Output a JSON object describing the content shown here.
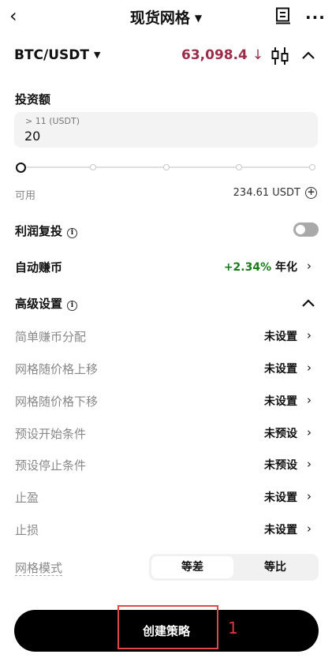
{
  "header": {
    "title": "现货网格"
  },
  "pair": {
    "symbol": "BTC/USDT",
    "price": "63,098.4",
    "price_color": "#9b2c4a"
  },
  "invest": {
    "label": "投资额",
    "hint": "> 11 (USDT)",
    "value": "20",
    "slider_level_percent": 0
  },
  "available": {
    "label": "可用",
    "value": "234.61 USDT"
  },
  "reinvest": {
    "label": "利润复投",
    "toggle_on": false
  },
  "auto_earn": {
    "label": "自动赚币",
    "rate": "+2.34%",
    "rate_suffix": "年化",
    "rate_color": "#1b7a1b"
  },
  "advanced": {
    "title": "高级设置",
    "rows": [
      {
        "label": "简单赚币分配",
        "value": "未设置"
      },
      {
        "label": "网格随价格上移",
        "value": "未设置"
      },
      {
        "label": "网格随价格下移",
        "value": "未设置"
      },
      {
        "label": "预设开始条件",
        "value": "未预设"
      },
      {
        "label": "预设停止条件",
        "value": "未预设"
      },
      {
        "label": "止盈",
        "value": "未设置"
      },
      {
        "label": "止损",
        "value": "未设置"
      }
    ]
  },
  "grid_mode": {
    "label": "网格模式",
    "options": [
      "等差",
      "等比"
    ],
    "selected": "等差"
  },
  "action": {
    "create_label": "创建策略",
    "annotation_number": "1",
    "annotation_color": "#e0454a"
  }
}
